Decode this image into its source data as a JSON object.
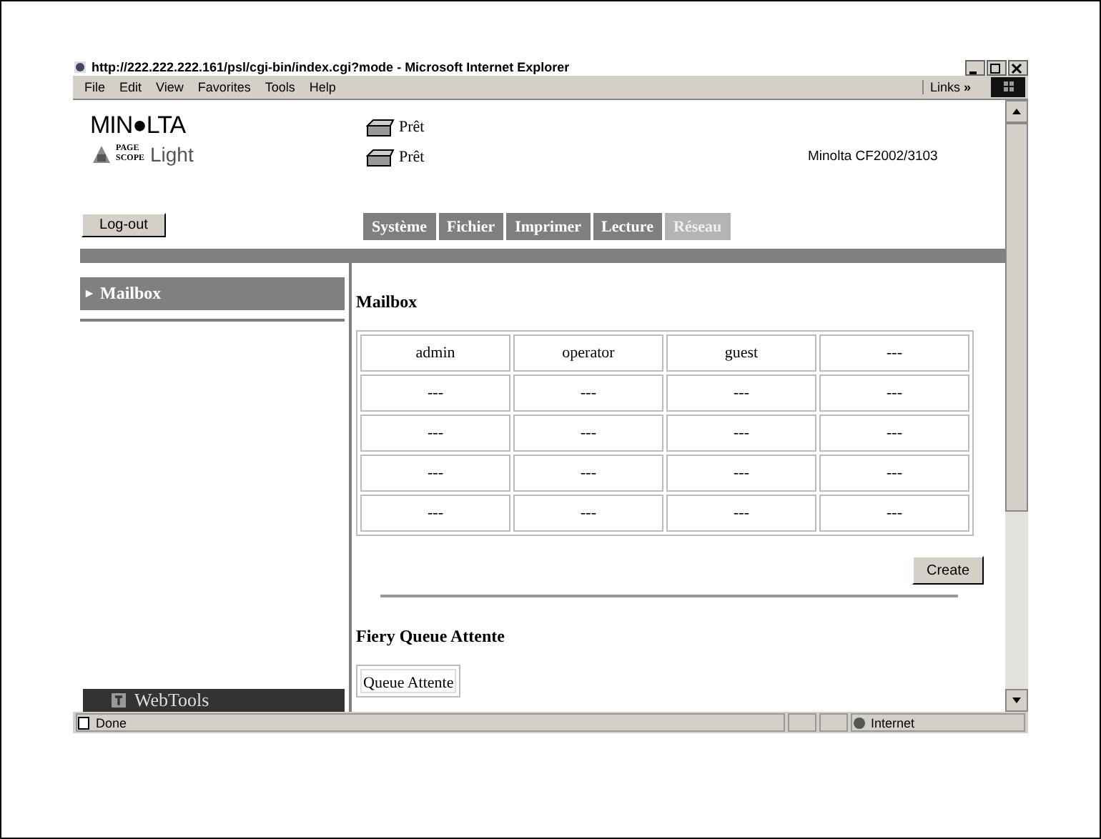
{
  "window": {
    "title": "http://222.222.222.161/psl/cgi-bin/index.cgi?mode - Microsoft Internet Explorer"
  },
  "menu": [
    "File",
    "Edit",
    "View",
    "Favorites",
    "Tools",
    "Help"
  ],
  "links_label": "Links",
  "links_chevron": "»",
  "header": {
    "brand": "MIN●LTA",
    "product_small": "PAGE SCOPE",
    "product": "Light",
    "statuses": [
      "Prêt",
      "Prêt"
    ],
    "model": "Minolta CF2002/3103"
  },
  "logout": "Log-out",
  "tabs": [
    {
      "label": "Système",
      "selected": false
    },
    {
      "label": "Fichier",
      "selected": false
    },
    {
      "label": "Imprimer",
      "selected": false
    },
    {
      "label": "Lecture",
      "selected": false
    },
    {
      "label": "Réseau",
      "selected": true
    }
  ],
  "sidebar": {
    "items": [
      {
        "label": "Mailbox",
        "selected": true
      }
    ],
    "footer": "WebTools"
  },
  "mailbox": {
    "title": "Mailbox",
    "rows": [
      [
        "admin",
        "operator",
        "guest",
        "---"
      ],
      [
        "---",
        "---",
        "---",
        "---"
      ],
      [
        "---",
        "---",
        "---",
        "---"
      ],
      [
        "---",
        "---",
        "---",
        "---"
      ],
      [
        "---",
        "---",
        "---",
        "---"
      ]
    ],
    "create": "Create"
  },
  "queue": {
    "title": "Fiery Queue Attente",
    "items": [
      "Queue Attente"
    ]
  },
  "status_bar": {
    "text": "Done",
    "zone": "Internet"
  }
}
